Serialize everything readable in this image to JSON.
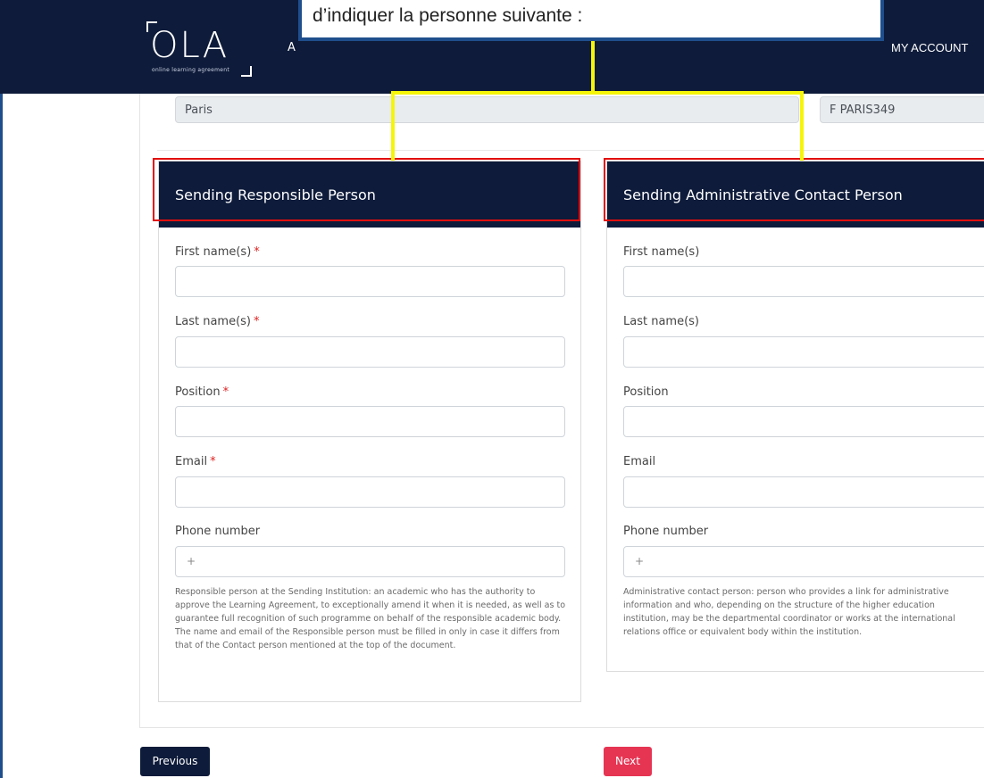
{
  "header": {
    "logo_text": "OLA",
    "logo_subtitle": "online learning agreement",
    "nav_partial_left": "A",
    "nav_account": "MY ACCOUNT"
  },
  "annotation": {
    "text": "d’indiquer la personne suivante :"
  },
  "previous_section": {
    "city_value": "Paris",
    "erasmus_code_value": "F  PARIS349"
  },
  "responsible_person": {
    "title": "Sending Responsible Person",
    "fields": {
      "first_name_label": "First name(s)",
      "last_name_label": "Last name(s)",
      "position_label": "Position",
      "email_label": "Email",
      "phone_label": "Phone number",
      "phone_placeholder": "+"
    },
    "required_marker": "*",
    "help_text": "Responsible person at the Sending Institution: an academic who has the authority to approve the Learning Agreement, to exceptionally amend it when it is needed, as well as to guarantee full recognition of such programme on behalf of the responsible academic body. The name and email of the Responsible person must be filled in only in case it differs from that of the Contact person mentioned at the top of the document."
  },
  "administrative_person": {
    "title": "Sending Administrative Contact Person",
    "fields": {
      "first_name_label": "First name(s)",
      "last_name_label": "Last name(s)",
      "position_label": "Position",
      "email_label": "Email",
      "phone_label": "Phone number",
      "phone_placeholder": "+"
    },
    "help_text": "Administrative contact person: person who provides a link for administrative information and who, depending on the structure of the higher education institution, may be the departmental coordinator or works at the international relations office or equivalent body within the institution."
  },
  "buttons": {
    "previous": "Previous",
    "next": "Next"
  },
  "colors": {
    "header_bg": "#0e1b3a",
    "annotation_border": "#1f4e8c",
    "highlight_yellow": "#f5f50a",
    "highlight_red": "#e10e0e",
    "required_red": "#e02020",
    "next_button": "#e63553"
  }
}
